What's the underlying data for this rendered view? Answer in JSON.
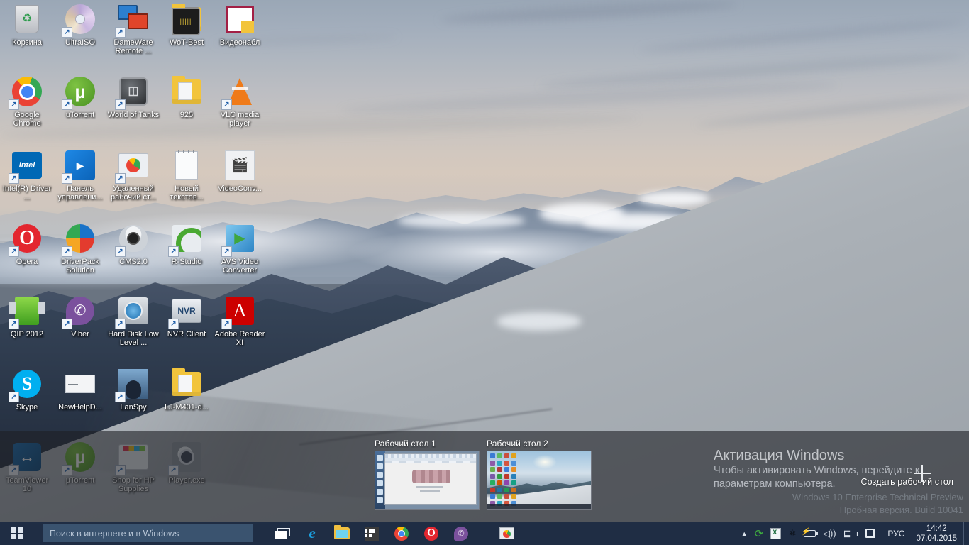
{
  "desktop": {
    "icons": [
      {
        "label": "Корзина",
        "art": "recycle",
        "shortcut": false,
        "col": 0,
        "row": 0
      },
      {
        "label": "UltraISO",
        "art": "disc",
        "shortcut": true,
        "col": 1,
        "row": 0
      },
      {
        "label": "DameWare Remote ...",
        "art": "monitors",
        "shortcut": true,
        "col": 2,
        "row": 0
      },
      {
        "label": "WoT-Best",
        "art": "folder-wot",
        "shortcut": false,
        "col": 3,
        "row": 0
      },
      {
        "label": "Видеонабл",
        "art": "video-folder",
        "shortcut": false,
        "col": 4,
        "row": 0
      },
      {
        "label": "Google Chrome",
        "art": "chrome",
        "shortcut": true,
        "col": 0,
        "row": 1
      },
      {
        "label": "uTorrent",
        "art": "utorrent",
        "shortcut": true,
        "col": 1,
        "row": 1
      },
      {
        "label": "World of Tanks",
        "art": "tank",
        "shortcut": true,
        "col": 2,
        "row": 1
      },
      {
        "label": "925",
        "art": "folder-doc",
        "shortcut": false,
        "col": 3,
        "row": 1
      },
      {
        "label": "VLC media player",
        "art": "vlc",
        "shortcut": true,
        "col": 4,
        "row": 1
      },
      {
        "label": "Intel(R) Driver ...",
        "art": "intel",
        "shortcut": true,
        "col": 0,
        "row": 2
      },
      {
        "label": "Панель управлени...",
        "art": "intel-panel",
        "shortcut": true,
        "col": 1,
        "row": 2
      },
      {
        "label": "Удаленный рабочий ст...",
        "art": "rdp",
        "shortcut": true,
        "col": 2,
        "row": 2
      },
      {
        "label": "Новый текстов...",
        "art": "notepad",
        "shortcut": false,
        "col": 3,
        "row": 2
      },
      {
        "label": "VideoConv...",
        "art": "videoconv",
        "shortcut": false,
        "col": 4,
        "row": 2
      },
      {
        "label": "Opera",
        "art": "opera",
        "shortcut": true,
        "col": 0,
        "row": 3
      },
      {
        "label": "DriverPack Solution",
        "art": "driverpack",
        "shortcut": true,
        "col": 1,
        "row": 3
      },
      {
        "label": "CMS2.0",
        "art": "cms",
        "shortcut": true,
        "col": 2,
        "row": 3
      },
      {
        "label": "R-Studio",
        "art": "rstudio",
        "shortcut": true,
        "col": 3,
        "row": 3
      },
      {
        "label": "AVS Video Converter",
        "art": "avs",
        "shortcut": true,
        "col": 4,
        "row": 3
      },
      {
        "label": "QIP 2012",
        "art": "qip",
        "shortcut": true,
        "col": 0,
        "row": 4
      },
      {
        "label": "Viber",
        "art": "viber",
        "shortcut": true,
        "col": 1,
        "row": 4
      },
      {
        "label": "Hard Disk Low Level ...",
        "art": "hdd",
        "shortcut": true,
        "col": 2,
        "row": 4
      },
      {
        "label": "NVR Client",
        "art": "nvr",
        "shortcut": true,
        "col": 3,
        "row": 4
      },
      {
        "label": "Adobe Reader XI",
        "art": "adobe",
        "shortcut": true,
        "col": 4,
        "row": 4
      },
      {
        "label": "Skype",
        "art": "skype",
        "shortcut": true,
        "col": 0,
        "row": 5
      },
      {
        "label": "NewHelpD...",
        "art": "helpdoc",
        "shortcut": false,
        "col": 1,
        "row": 5
      },
      {
        "label": "LanSpy",
        "art": "lanspy",
        "shortcut": true,
        "col": 2,
        "row": 5
      },
      {
        "label": "LJ-M401-d...",
        "art": "folder-doc",
        "shortcut": false,
        "col": 3,
        "row": 5
      },
      {
        "label": "TeamViewer 10",
        "art": "teamviewer",
        "shortcut": true,
        "col": 0,
        "row": 6
      },
      {
        "label": "µTorrent",
        "art": "utorrent",
        "shortcut": true,
        "col": 1,
        "row": 6
      },
      {
        "label": "Shop for HP Supplies",
        "art": "printer",
        "shortcut": true,
        "col": 2,
        "row": 6
      },
      {
        "label": "Player.exe",
        "art": "player",
        "shortcut": true,
        "col": 3,
        "row": 6
      }
    ]
  },
  "taskview": {
    "desktops": [
      {
        "label": "Рабочий стол 1"
      },
      {
        "label": "Рабочий стол 2"
      }
    ],
    "create_label": "Создать рабочий стол"
  },
  "activation": {
    "title": "Активация Windows",
    "line1": "Чтобы активировать Windows, перейдите к",
    "line2": "параметрам компьютера.",
    "edition": "Windows 10 Enterprise Technical Preview",
    "build": "Пробная версия. Build 10041"
  },
  "taskbar": {
    "start_name": "start-button",
    "search_placeholder": "Поиск в интернете и в Windows",
    "buttons": [
      {
        "name": "task-view-button",
        "icon": "task-view-icon"
      },
      {
        "name": "internet-explorer-button",
        "icon": "internet-explorer-icon",
        "glyph": "e"
      },
      {
        "name": "file-explorer-button",
        "icon": "file-explorer-icon"
      },
      {
        "name": "store-button",
        "icon": "store-icon"
      },
      {
        "name": "chrome-button",
        "icon": "chrome-icon"
      },
      {
        "name": "opera-button",
        "icon": "opera-icon",
        "glyph": "O"
      },
      {
        "name": "viber-button",
        "icon": "viber-icon",
        "glyph": "✆"
      },
      {
        "name": "remote-desktop-button",
        "icon": "remote-desktop-icon"
      }
    ],
    "tray": {
      "chevron": "▲",
      "items": [
        {
          "name": "sync-tray-icon",
          "glyph": "⟳"
        },
        {
          "name": "excel-tray-icon"
        },
        {
          "name": "molecule-tray-icon",
          "glyph": "⚛"
        },
        {
          "name": "battery-tray-icon"
        },
        {
          "name": "volume-tray-icon",
          "glyph": "🔊"
        },
        {
          "name": "network-tray-icon",
          "glyph": "🖧"
        },
        {
          "name": "action-center-icon"
        }
      ],
      "language": "РУС",
      "time": "14:42",
      "date": "07.04.2015"
    }
  }
}
